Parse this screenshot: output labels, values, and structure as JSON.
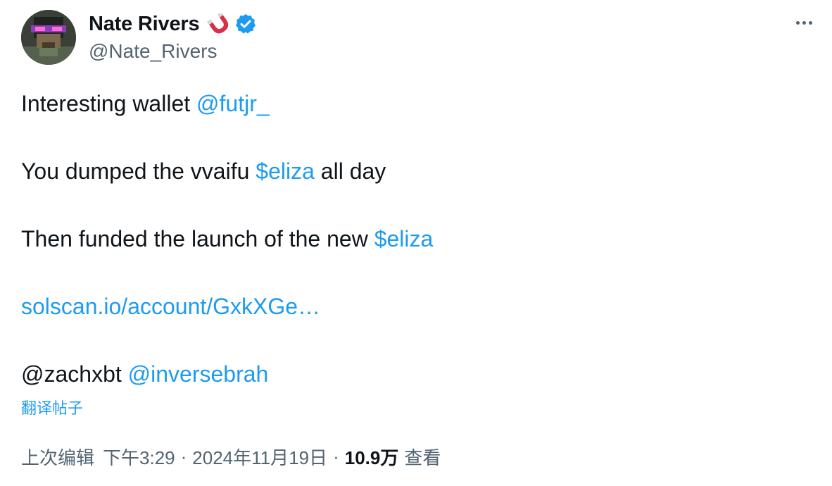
{
  "author": {
    "display_name": "Nate Rivers",
    "handle": "@Nate_Rivers",
    "name_emoji": "magnet-icon",
    "verified": true,
    "verified_color": "#1d9bf0"
  },
  "more_icon": "more-horizontal-icon",
  "tweet": {
    "line1_text": "Interesting wallet ",
    "line1_mention": "@futjr_",
    "line2_text_a": "You dumped the vvaifu ",
    "line2_cashtag": "$eliza",
    "line2_text_b": " all day",
    "line3_text": "Then funded the launch of the new ",
    "line3_cashtag": "$eliza",
    "link_text": "solscan.io/account/GxkXGe…",
    "line5_mention_a": "@zachxbt",
    "line5_mention_b": "@inversebrah"
  },
  "translate_label": "翻译帖子",
  "meta": {
    "edited_label": "上次编辑",
    "time": "下午3:29",
    "separator": "·",
    "date": "2024年11月19日",
    "views_count": "10.9万",
    "views_label": "查看"
  },
  "colors": {
    "link": "#1d9bf0",
    "text": "#0f1419",
    "secondary": "#536471"
  }
}
